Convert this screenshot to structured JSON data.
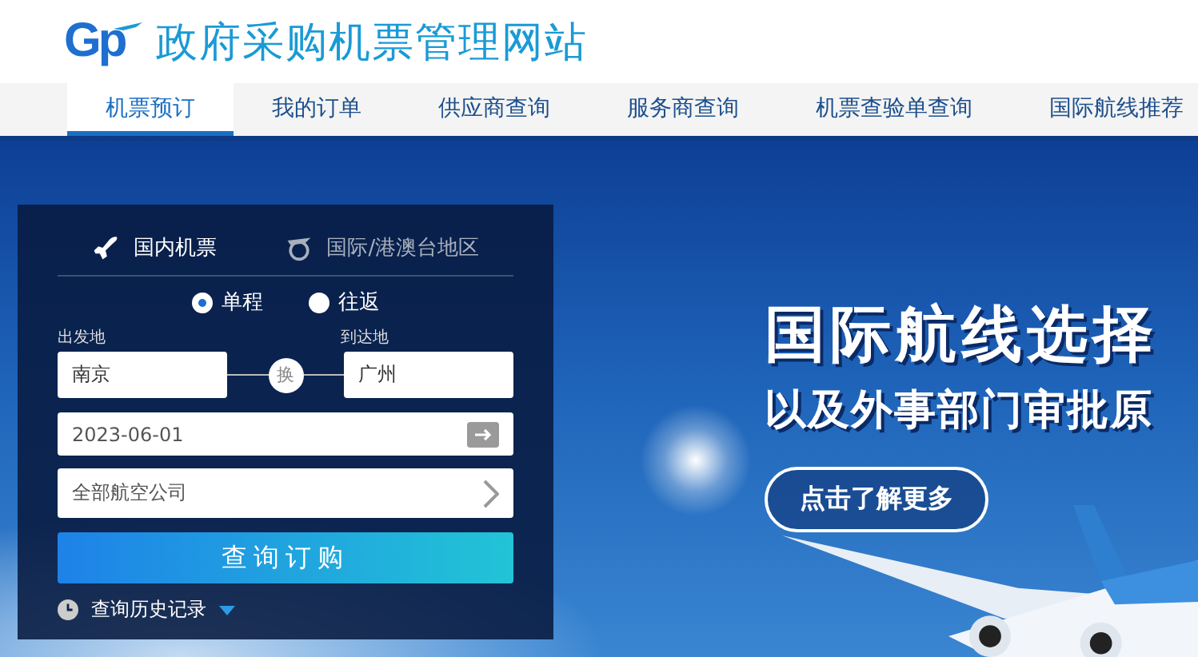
{
  "header": {
    "logo_text": "Gp",
    "title": "政府采购机票管理网站"
  },
  "nav": [
    {
      "label": "机票预订",
      "selected": true
    },
    {
      "label": "我的订单",
      "selected": false
    },
    {
      "label": "供应商查询",
      "selected": false
    },
    {
      "label": "服务商查询",
      "selected": false
    },
    {
      "label": "机票查验单查询",
      "selected": false
    },
    {
      "label": "国际航线推荐",
      "selected": false
    }
  ],
  "booking": {
    "trip_tabs": [
      {
        "label": "国内机票",
        "kind": "domestic",
        "selected": true
      },
      {
        "label": "国际/港澳台地区",
        "kind": "international",
        "selected": false
      }
    ],
    "trip_types": [
      {
        "label": "单程",
        "selected": true
      },
      {
        "label": "往返",
        "selected": false
      }
    ],
    "origin": {
      "label": "出发地",
      "value": "南京"
    },
    "swap": "换",
    "destination": {
      "label": "到达地",
      "value": "广州"
    },
    "date": {
      "value": "2023-06-01"
    },
    "airline": {
      "value": "全部航空公司"
    },
    "search_button": "查询订购",
    "history": "查询历史记录"
  },
  "banner": {
    "headline": "国际航线选择",
    "subline": "以及外事部门审批原",
    "button": "点击了解更多"
  }
}
